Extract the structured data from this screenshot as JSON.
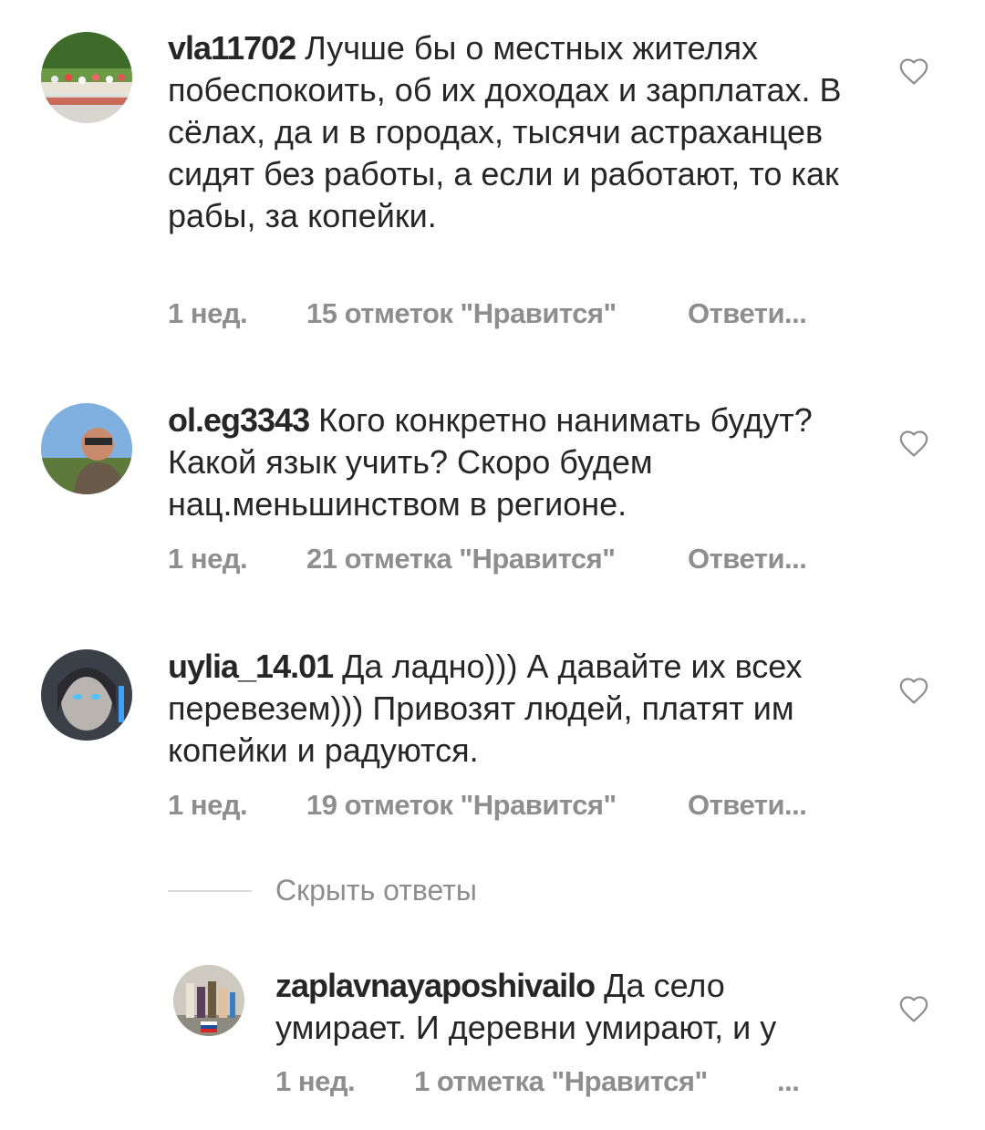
{
  "comments": [
    {
      "username": "vla11702",
      "text": " Лучше бы о местных жителях побеспокоить, об их доходах и зарплатах. В сёлах, да и в городах, тысячи астраханцев сидят без работы, а если и работают, то как рабы, за копейки.",
      "time": "1 нед.",
      "likes": "15 отметок \"Нравится\"",
      "reply": "Ответи..."
    },
    {
      "username": "ol.eg3343",
      "text": " Кого конкретно нанимать будут? Какой язык учить? Скоро будем нац.меньшинством в регионе.",
      "time": "1 нед.",
      "likes": "21 отметка \"Нравится\"",
      "reply": "Ответи..."
    },
    {
      "username": "uylia_14.01",
      "text": " Да ладно))) А давайте их всех перевезем))) Привозят людей, платят им копейки и радуются.",
      "time": "1 нед.",
      "likes": "19 отметок \"Нравится\"",
      "reply": "Ответи..."
    }
  ],
  "hide_replies": "Скрыть ответы",
  "reply_comment": {
    "username": "zaplavnayaposhivailo",
    "text": " Да село умирает. И деревни умирают, и у",
    "time": "1 нед.",
    "likes": "1 отметка \"Нравится\"",
    "more": "..."
  },
  "icons": {
    "like": "heart-outline-icon"
  }
}
